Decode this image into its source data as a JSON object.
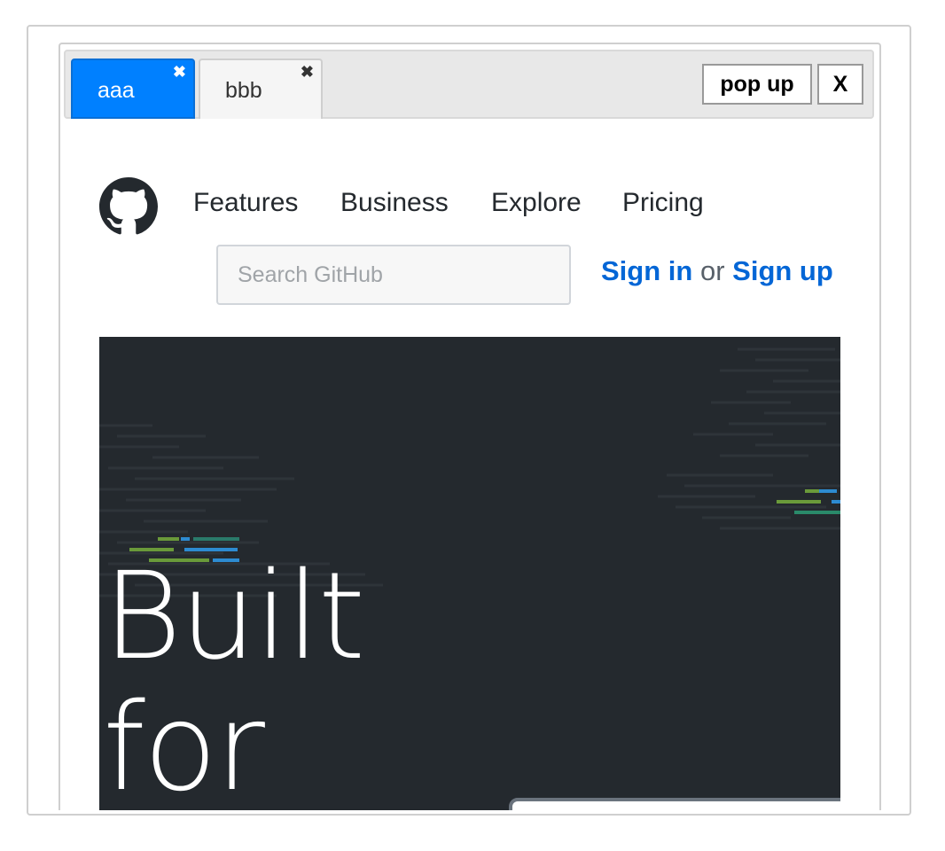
{
  "tabs": [
    {
      "label": "aaa",
      "close": "✖",
      "active": true
    },
    {
      "label": "bbb",
      "close": "✖",
      "active": false
    }
  ],
  "toolbar": {
    "popup_label": "pop up",
    "close_label": "X"
  },
  "site": {
    "logo_icon": "github-octocat-icon",
    "nav": [
      "Features",
      "Business",
      "Explore",
      "Pricing"
    ],
    "search_placeholder": "Search GitHub",
    "sign_in": "Sign in",
    "or_text": "or",
    "sign_up": "Sign up"
  },
  "hero": {
    "line1": "Built",
    "line2": "for"
  },
  "colors": {
    "active_tab": "#0080ff",
    "link": "#0366d6",
    "hero_bg": "#24292e"
  }
}
